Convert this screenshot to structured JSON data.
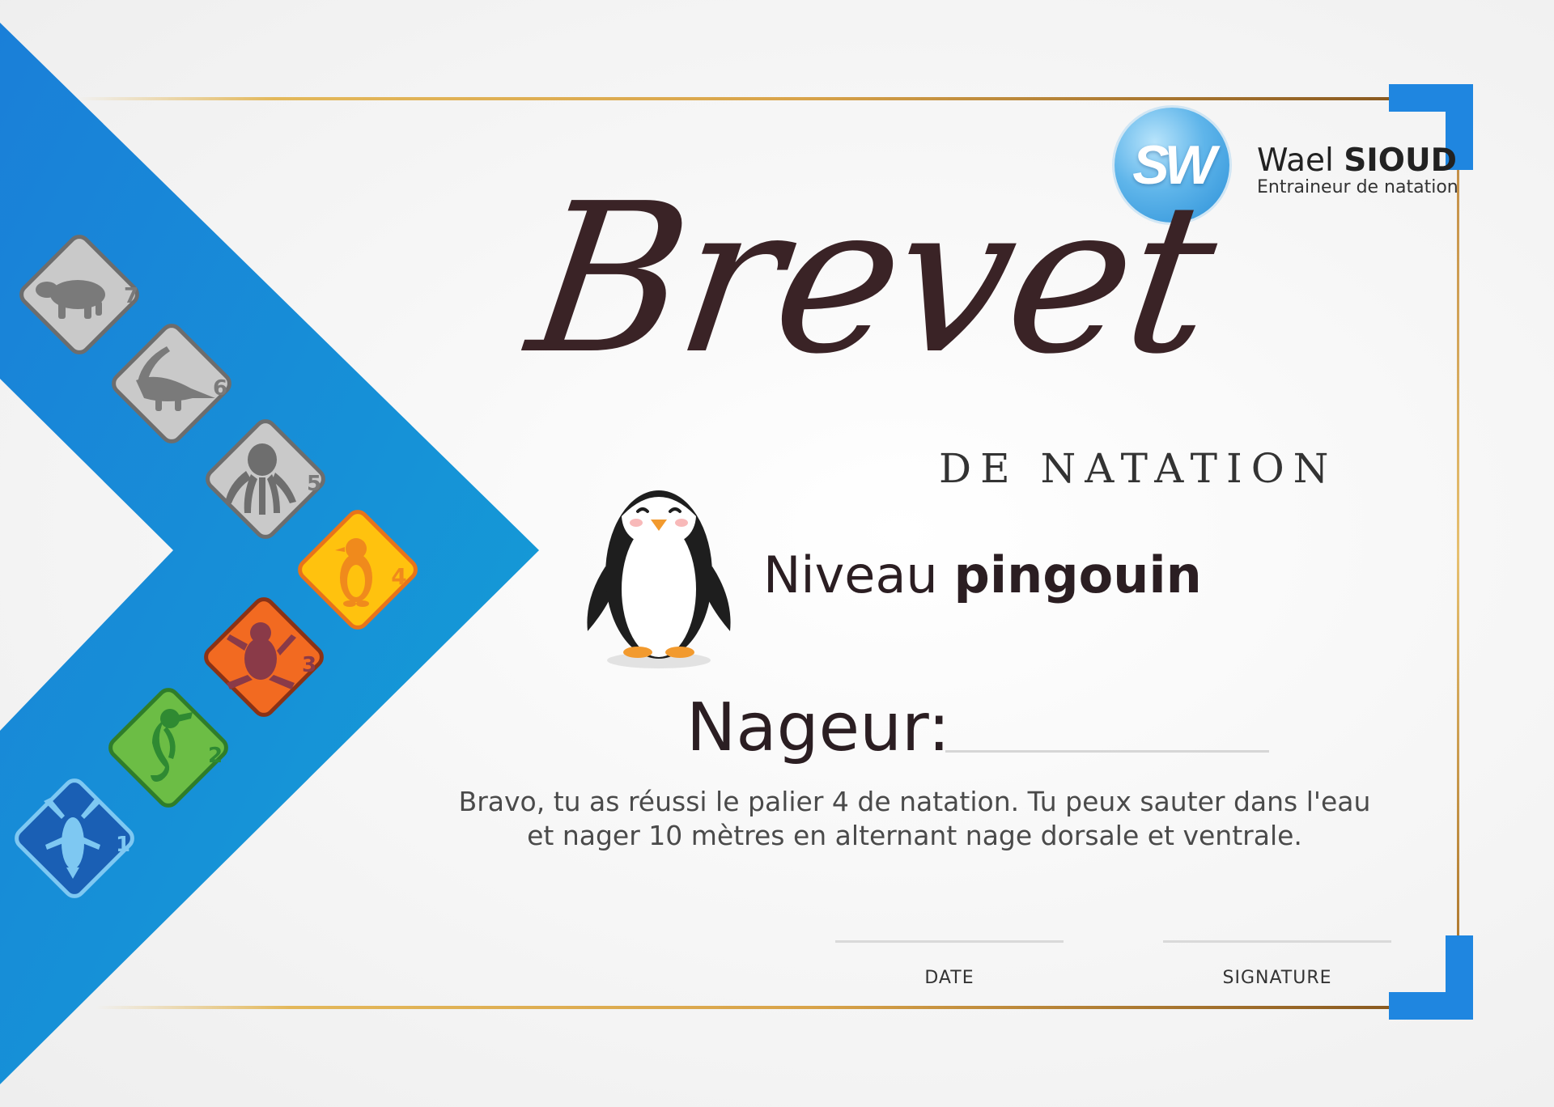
{
  "logo": {
    "initials": "SW"
  },
  "coach": {
    "first_name": "Wael",
    "last_name": "SIOUD",
    "title": "Entraineur de natation"
  },
  "certificate": {
    "title": "Brevet",
    "subtitle": "DE NATATION",
    "level_prefix": "Niveau",
    "level_name": "pingouin",
    "swimmer_label": "Nageur:",
    "message_line1": "Bravo, tu as réussi le palier 4 de natation. Tu peux sauter dans l'eau",
    "message_line2": "et nager 10 mètres en alternant nage dorsale et ventrale.",
    "date_label": "DATE",
    "signature_label": "SIGNATURE"
  },
  "levels": [
    {
      "number": "7",
      "animal": "polar-bear-icon",
      "color": "#c9c9c9"
    },
    {
      "number": "6",
      "animal": "crocodile-icon",
      "color": "#c9c9c9"
    },
    {
      "number": "5",
      "animal": "octopus-icon",
      "color": "#c9c9c9"
    },
    {
      "number": "4",
      "animal": "penguin-icon",
      "color": "#ffc107"
    },
    {
      "number": "3",
      "animal": "frog-icon",
      "color": "#f26a21"
    },
    {
      "number": "2",
      "animal": "seahorse-icon",
      "color": "#6cbd45"
    },
    {
      "number": "1",
      "animal": "lobster-icon",
      "color": "#1a5fb4"
    }
  ],
  "colors": {
    "accent_blue": "#1f86e0",
    "gold": "#d9a44a",
    "title": "#3a2326"
  }
}
